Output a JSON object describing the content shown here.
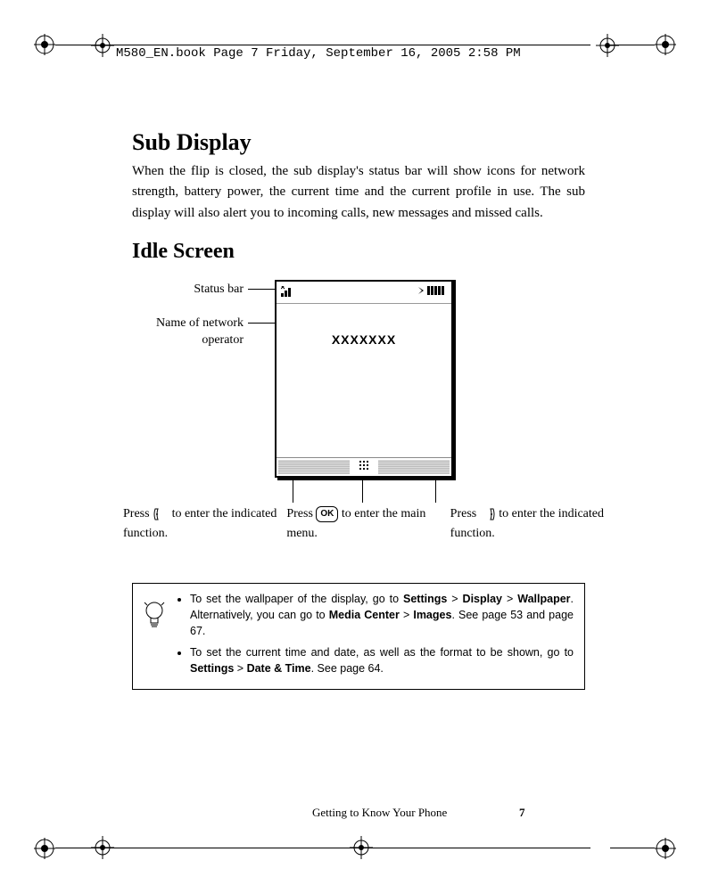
{
  "print_header": "M580_EN.book  Page 7  Friday, September 16, 2005  2:58 PM",
  "section1": {
    "title": "Sub Display",
    "body": "When the flip is closed, the sub display's status bar will show icons for network strength, battery power, the current time and the current profile in use. The sub display will also alert you to incoming calls, new messages and missed calls."
  },
  "section2": {
    "title": "Idle Screen",
    "labels": {
      "status_bar": "Status bar",
      "network_operator": "Name of network operator"
    },
    "screen": {
      "network_name": "XXXXXXX"
    },
    "callouts": {
      "left": {
        "pre": "Press",
        "post": "to enter the indicated function."
      },
      "center": {
        "pre": "Press",
        "mid": "OK",
        "post": "to enter the main menu."
      },
      "right": {
        "pre": "Press",
        "post": "to enter the indicated function."
      }
    }
  },
  "tips": {
    "item1": {
      "t1": "To set the wallpaper of the display, go to ",
      "b1": "Settings",
      "sep": " > ",
      "b2": "Display",
      "b3": "Wallpaper",
      "t2": ".  Alternatively, you can go to ",
      "b4": "Media Center",
      "b5": "Images",
      "t3": ". See page 53 and page 67."
    },
    "item2": {
      "t1": "To set the current time and date, as well as the format to be shown, go to ",
      "b1": "Settings",
      "sep": " > ",
      "b2": "Date & Time",
      "t2": ". See page 64."
    }
  },
  "footer": {
    "text": "Getting to Know Your Phone",
    "page": "7"
  }
}
